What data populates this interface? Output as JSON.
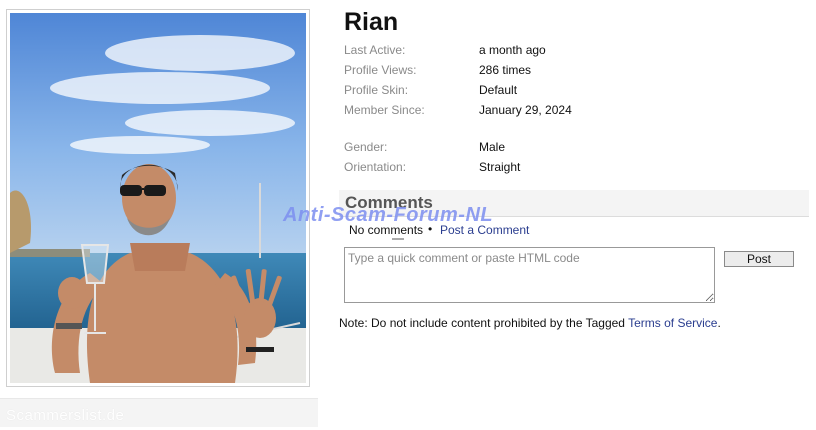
{
  "profile": {
    "name": "Rian",
    "info": [
      {
        "label": "Last Active:",
        "value": "a month ago"
      },
      {
        "label": "Profile Views:",
        "value": "286 times"
      },
      {
        "label": "Profile Skin:",
        "value": "Default"
      },
      {
        "label": "Member Since:",
        "value": "January 29, 2024"
      },
      {
        "label": "Gender:",
        "value": "Male"
      },
      {
        "label": "Orientation:",
        "value": "Straight"
      }
    ]
  },
  "comments": {
    "title": "Comments",
    "no_comments": "No comments",
    "separator": "•",
    "post_link": "Post a Comment",
    "placeholder": "Type a quick comment or paste HTML code",
    "post_button": "Post",
    "note_prefix": "Note: Do not include content prohibited by the Tagged ",
    "note_link": "Terms of Service",
    "note_suffix": "."
  },
  "watermarks": {
    "overlay": "Anti-Scam-Forum-NL",
    "bottom": "Scammerslist.de"
  },
  "colors": {
    "link": "#2a3d8f",
    "watermark": "#7d8ff0",
    "label": "#8a8a8a"
  }
}
